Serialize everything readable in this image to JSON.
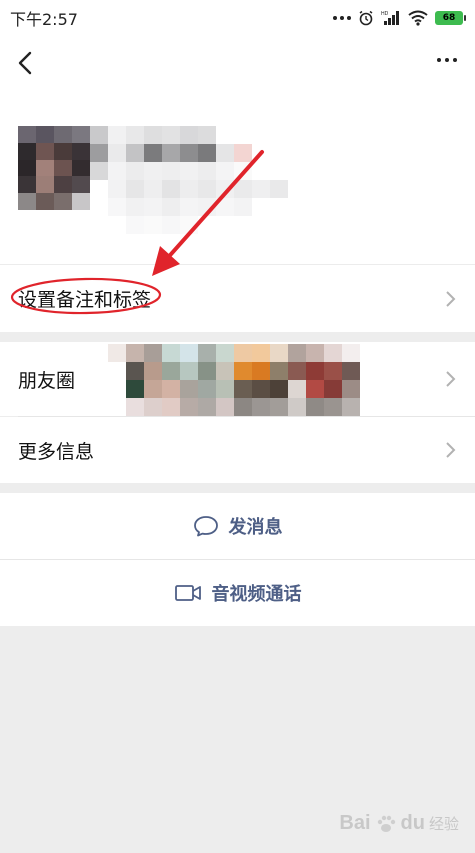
{
  "status_bar": {
    "time": "下午2:57",
    "battery": "68",
    "icons": [
      "more-dots-icon",
      "alarm-icon",
      "hd-signal-icon",
      "wifi-icon",
      "battery-icon"
    ]
  },
  "nav": {
    "back_icon": "back-chevron-icon",
    "more_icon": "more-dots-icon"
  },
  "rows": {
    "remark_label": "设置备注和标签",
    "moments_label": "朋友圈",
    "more_info_label": "更多信息"
  },
  "actions": {
    "message_label": "发消息",
    "call_label": "音视频通话"
  },
  "annotation": {
    "color": "#e0242b"
  },
  "watermark": {
    "brand": "Bai",
    "brand2": "du",
    "sub": "经验"
  },
  "colors": {
    "background": "#ededed",
    "action_text": "#4e5f86"
  }
}
